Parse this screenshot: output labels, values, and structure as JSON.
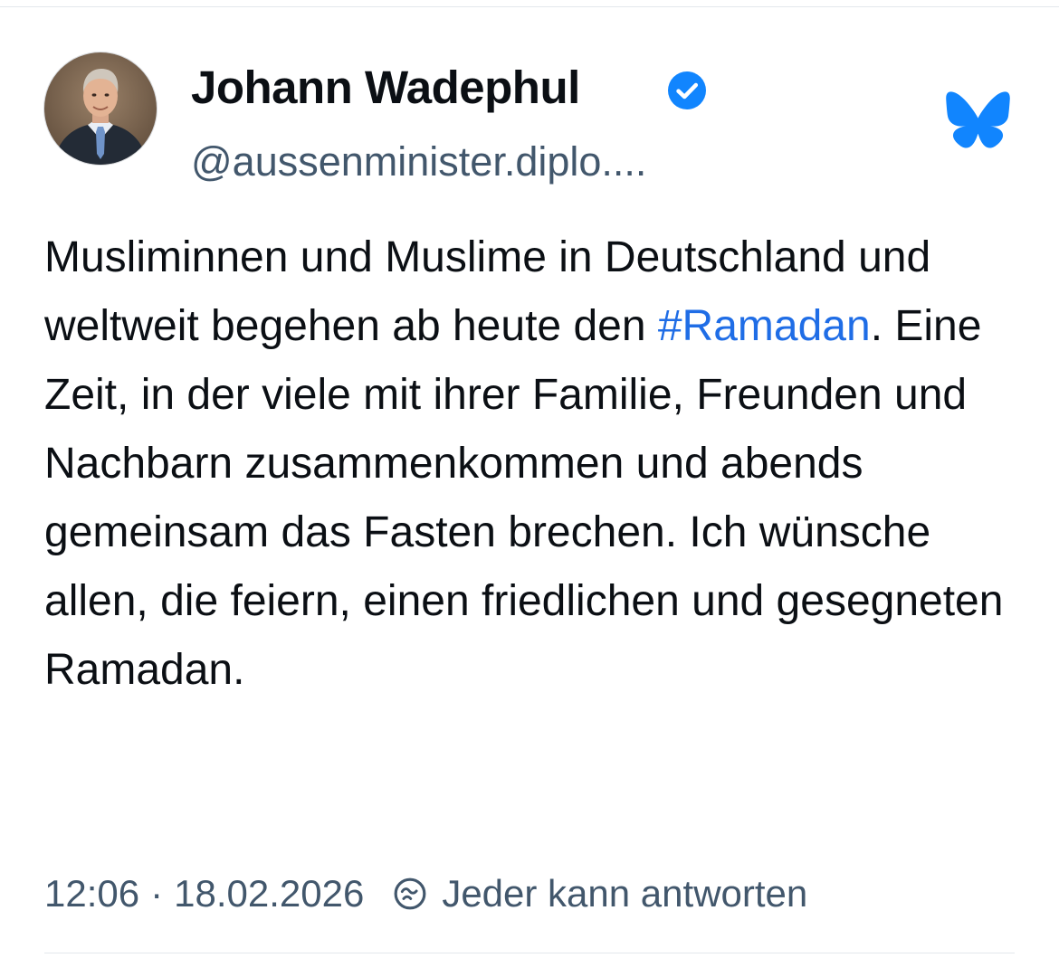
{
  "post": {
    "author": {
      "display_name": "Johann Wadephul",
      "handle": "@aussenminister.diplo....",
      "verified": true
    },
    "text": {
      "before_tag": "Musliminnen und Muslime in Deutschland und weltweit begehen ab heute den ",
      "hashtag": "#Ramadan",
      "after_tag": ". Eine Zeit, in der viele mit ihrer Familie, Freunden und Nachbarn zusammenkommen und abends gemeinsam das Fasten brechen. Ich wünsche allen, die feiern, einen friedlichen und gesegneten Ramadan."
    },
    "meta": {
      "time": "12:06",
      "separator": "·",
      "date": "18.02.2026",
      "reply_setting": "Jeder kann antworten"
    }
  },
  "icons": {
    "verified": "verified-badge-icon",
    "app_logo": "bluesky-butterfly-icon",
    "reply_setting": "everybody-can-reply-icon"
  },
  "colors": {
    "text": "#0b0f14",
    "secondary_text": "#42576c",
    "accent": "#1f6de6",
    "logo_blue": "#1185fe"
  }
}
